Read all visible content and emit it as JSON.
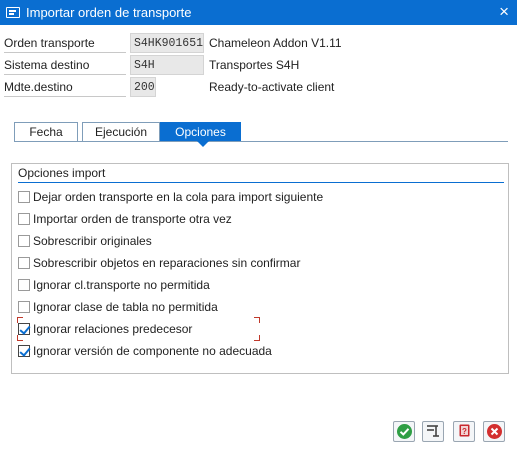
{
  "window": {
    "title": "Importar orden de transporte",
    "close_glyph": "×"
  },
  "fields": [
    {
      "label": "Orden transporte",
      "value": "S4HK901651",
      "description": "Chameleon Addon V1.11"
    },
    {
      "label": "Sistema destino",
      "value": "S4H",
      "description": "Transportes S4H"
    },
    {
      "label": "Mdte.destino",
      "value": "200",
      "description": "Ready-to-activate client"
    }
  ],
  "tabs": [
    {
      "label": "Fecha",
      "active": false
    },
    {
      "label": "Ejecución",
      "active": false
    },
    {
      "label": "Opciones",
      "active": true
    }
  ],
  "options_group": {
    "title": "Opciones import",
    "items": [
      {
        "label": "Dejar orden transporte en la cola para import siguiente",
        "checked": false
      },
      {
        "label": "Importar orden de transporte otra vez",
        "checked": false
      },
      {
        "label": "Sobrescribir originales",
        "checked": false
      },
      {
        "label": "Sobrescribir objetos en reparaciones sin confirmar",
        "checked": false
      },
      {
        "label": "Ignorar cl.transporte no permitida",
        "checked": false
      },
      {
        "label": "Ignorar clase de tabla no permitida",
        "checked": false
      },
      {
        "label": "Ignorar relaciones predecesor",
        "checked": true
      },
      {
        "label": "Ignorar versión de componente no adecuada",
        "checked": true
      }
    ]
  },
  "footer_buttons": [
    {
      "name": "confirm",
      "icon": "check-icon",
      "color": "#2e9e44"
    },
    {
      "name": "execute-in-background",
      "icon": "execute-icon",
      "color": "#555555"
    },
    {
      "name": "help",
      "icon": "help-book-icon",
      "color": "#c8282e"
    },
    {
      "name": "cancel",
      "icon": "cancel-icon",
      "color": "#d32f2f"
    }
  ],
  "colors": {
    "accent": "#0a6ed1",
    "checkmark": "#0a6ed1"
  }
}
